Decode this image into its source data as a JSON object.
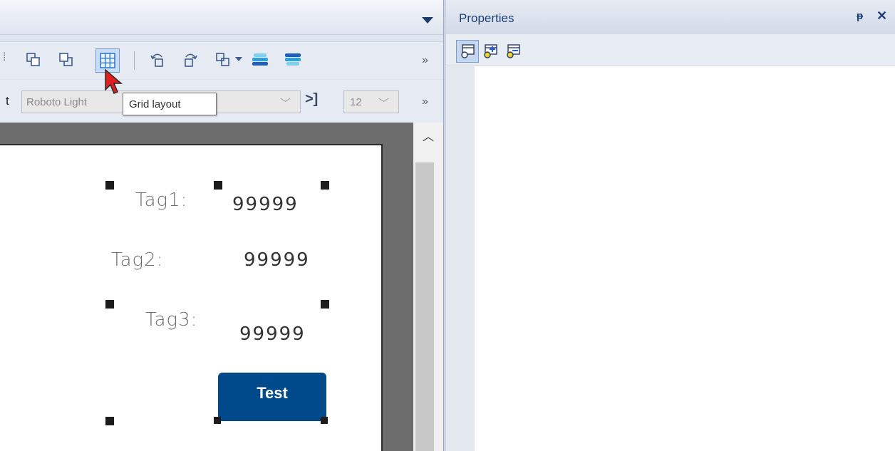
{
  "toolbar": {
    "font_label_fragment": "t",
    "font_family_value": "Roboto Light",
    "font_size_value": "12",
    "overflow_glyph": "»",
    "tooltip_text": "Grid layout",
    "icons": [
      "bring-forward-icon",
      "send-backward-icon",
      "grid-layout-icon",
      "rotate-left-icon",
      "rotate-right-icon",
      "group-icon",
      "dropdown-icon",
      "layer-up-icon",
      "layer-down-icon"
    ]
  },
  "canvas": {
    "tags": [
      {
        "label": "Tag1:",
        "value": "99999"
      },
      {
        "label": "Tag2:",
        "value": "99999"
      },
      {
        "label": "Tag3:",
        "value": "99999"
      }
    ],
    "button_label": "Test",
    "button_color": "#004a8c"
  },
  "properties": {
    "title": "Properties",
    "pin_glyph": "ᵽ",
    "close_glyph": "✕",
    "toolbar_icons": [
      "properties-view-icon",
      "add-property-icon",
      "events-view-icon"
    ]
  },
  "colors": {
    "accent": "#1b3f77",
    "canvas_bg": "#6d6d6d"
  }
}
